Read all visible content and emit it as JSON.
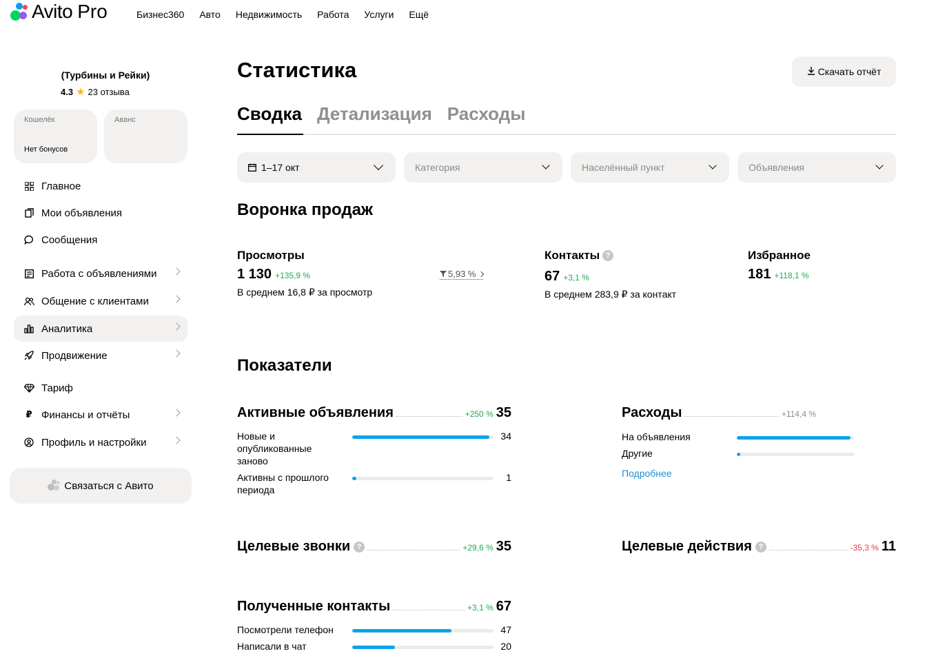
{
  "brand": {
    "name": "Avito",
    "suffix": "Pro"
  },
  "topnav": [
    "Бизнес360",
    "Авто",
    "Недвижимость",
    "Работа",
    "Услуги",
    "Ещё"
  ],
  "profile": {
    "company": "(Турбины и Рейки)",
    "rating": "4.3",
    "reviews": "23 отзыва"
  },
  "wallet": {
    "label": "Кошелёк",
    "value": "Нет бонусов"
  },
  "advance": {
    "label": "Аванс"
  },
  "menu": [
    "Главное",
    "Мои объявления",
    "Сообщения",
    "Работа с объявлениями",
    "Общение с клиентами",
    "Аналитика",
    "Продвижение",
    "Тариф",
    "Финансы и отчёты",
    "Профиль и настройки"
  ],
  "contact_button": "Связаться с Авито",
  "page_title": "Статистика",
  "download_button": "Скачать отчёт",
  "tabs": [
    "Сводка",
    "Детализация",
    "Расходы"
  ],
  "filters": [
    "1–17 окт",
    "Категория",
    "Населённый пункт",
    "Объявления"
  ],
  "funnel": {
    "title": "Воронка продаж",
    "views": {
      "label": "Просмотры",
      "value": "1 130",
      "delta": "+135,9 %",
      "conversion": "5,93 %",
      "note": "В среднем 16,8 ₽ за просмотр"
    },
    "contacts": {
      "label": "Контакты",
      "value": "67",
      "delta": "+3,1 %",
      "note": "В среднем 283,9 ₽ за контакт"
    },
    "favorites": {
      "label": "Избранное",
      "value": "181",
      "delta": "+118,1 %"
    }
  },
  "metrics": {
    "title": "Показатели",
    "active_ads": {
      "label": "Активные объявления",
      "delta": "+250 %",
      "value": "35",
      "rows": [
        {
          "label": "Новые и опубликованные заново",
          "value": "34",
          "fraction": 0.97
        },
        {
          "label": "Активны с прошлого периода",
          "value": "1",
          "fraction": 0.03
        }
      ]
    },
    "expenses": {
      "label": "Расходы",
      "delta": "+114,4 %",
      "rows": [
        {
          "label": "На объявления",
          "fraction": 0.97
        },
        {
          "label": "Другие",
          "fraction": 0.03
        }
      ],
      "more_link": "Подробнее"
    },
    "calls": {
      "label": "Целевые звонки",
      "delta": "+29,6 %",
      "value": "35"
    },
    "actions": {
      "label": "Целевые действия",
      "delta": "-35,3 %",
      "value": "11"
    },
    "received": {
      "label": "Полученные контакты",
      "delta": "+3,1 %",
      "value": "67",
      "rows": [
        {
          "label": "Посмотрели телефон",
          "value": "47",
          "fraction": 0.7
        },
        {
          "label": "Написали в чат",
          "value": "20",
          "fraction": 0.3
        }
      ]
    }
  },
  "colors": {
    "accent_blue": "#0aa3ec",
    "positive": "#1faa50",
    "negative": "#e8384a",
    "surface": "#f2f1f0"
  }
}
